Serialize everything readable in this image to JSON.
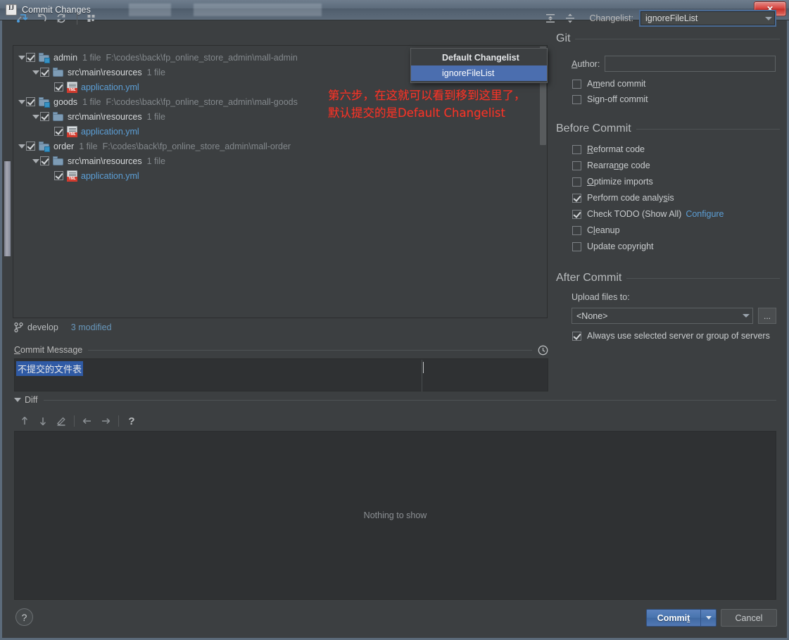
{
  "window": {
    "title": "Commit Changes",
    "app_icon": "intellij-idea-icon",
    "close_label": "✕"
  },
  "toolbar": {
    "buttons": [
      {
        "name": "show-diff-icon",
        "tip": "Show Diff"
      },
      {
        "name": "revert-icon",
        "tip": "Revert"
      },
      {
        "name": "refresh-icon",
        "tip": "Refresh"
      },
      {
        "name": "group-by-icon",
        "tip": "Group By"
      }
    ],
    "expand_all": "expand-all-icon",
    "collapse_all": "collapse-all-icon",
    "changelist_label": "Changelist:",
    "changelist_value": "ignoreFileList"
  },
  "dropdown": {
    "open": true,
    "items": [
      {
        "label": "Default Changelist",
        "bold": true,
        "selected": false
      },
      {
        "label": "ignoreFileList",
        "bold": false,
        "selected": true
      }
    ]
  },
  "tree": [
    {
      "indent": 0,
      "twisty": true,
      "checked": true,
      "icon": "folder-modified-icon",
      "name": "admin",
      "count": "1 file",
      "path": "F:\\codes\\back\\fp_online_store_admin\\mall-admin",
      "link": false
    },
    {
      "indent": 1,
      "twisty": true,
      "checked": true,
      "icon": "folder-icon",
      "name": "src\\main\\resources",
      "count": "1 file",
      "path": "",
      "link": false
    },
    {
      "indent": 2,
      "twisty": false,
      "checked": true,
      "icon": "yml-file-icon",
      "name": "application.yml",
      "count": "",
      "path": "",
      "link": true
    },
    {
      "indent": 0,
      "twisty": true,
      "checked": true,
      "icon": "folder-modified-icon",
      "name": "goods",
      "count": "1 file",
      "path": "F:\\codes\\back\\fp_online_store_admin\\mall-goods",
      "link": false
    },
    {
      "indent": 1,
      "twisty": true,
      "checked": true,
      "icon": "folder-icon",
      "name": "src\\main\\resources",
      "count": "1 file",
      "path": "",
      "link": false
    },
    {
      "indent": 2,
      "twisty": false,
      "checked": true,
      "icon": "yml-file-icon",
      "name": "application.yml",
      "count": "",
      "path": "",
      "link": true
    },
    {
      "indent": 0,
      "twisty": true,
      "checked": true,
      "icon": "folder-modified-icon",
      "name": "order",
      "count": "1 file",
      "path": "F:\\codes\\back\\fp_online_store_admin\\mall-order",
      "link": false
    },
    {
      "indent": 1,
      "twisty": true,
      "checked": true,
      "icon": "folder-icon",
      "name": "src\\main\\resources",
      "count": "1 file",
      "path": "",
      "link": false
    },
    {
      "indent": 2,
      "twisty": false,
      "checked": true,
      "icon": "yml-file-icon",
      "name": "application.yml",
      "count": "",
      "path": "",
      "link": true
    }
  ],
  "annotation": {
    "line1": "第六步，在这就可以看到移到这里了，",
    "line2": "默认提交的是Default Changelist",
    "color": "#f0372b"
  },
  "status": {
    "branch_icon": "git-branch-icon",
    "branch": "develop",
    "modified": "3 modified",
    "modified_color": "#6897bb"
  },
  "commit_message": {
    "label": "Commit Message",
    "history_icon": "clock-history-icon",
    "value": "不提交的文件表",
    "selection_color": "#2f5aa5"
  },
  "diff": {
    "label": "Diff",
    "buttons": [
      {
        "name": "previous-difference-icon",
        "glyph": "↑"
      },
      {
        "name": "next-difference-icon",
        "glyph": "↓"
      },
      {
        "name": "edit-source-icon",
        "glyph": "✎"
      },
      {
        "name": "accept-left-icon",
        "glyph": "←"
      },
      {
        "name": "accept-right-icon",
        "glyph": "→"
      },
      {
        "name": "diff-help-icon",
        "glyph": "?"
      }
    ],
    "empty_text": "Nothing to show"
  },
  "right_panel": {
    "git": {
      "group_label": "Git",
      "author_label": "Author:",
      "author_value": "",
      "checkboxes": [
        {
          "name": "amend-commit",
          "label": "Amend commit",
          "checked": false
        },
        {
          "name": "sign-off-commit",
          "label": "Sign-off commit",
          "checked": false
        }
      ]
    },
    "before_commit": {
      "group_label": "Before Commit",
      "checkboxes": [
        {
          "name": "reformat-code",
          "label": "Reformat code",
          "checked": false
        },
        {
          "name": "rearrange-code",
          "label": "Rearrange code",
          "checked": false
        },
        {
          "name": "optimize-imports",
          "label": "Optimize imports",
          "checked": false
        },
        {
          "name": "perform-code-analysis",
          "label": "Perform code analysis",
          "checked": true
        },
        {
          "name": "check-todo",
          "label": "Check TODO (Show All)",
          "checked": true,
          "link": "Configure"
        },
        {
          "name": "cleanup",
          "label": "Cleanup",
          "checked": false
        },
        {
          "name": "update-copyright",
          "label": "Update copyright",
          "checked": false
        }
      ]
    },
    "after_commit": {
      "group_label": "After Commit",
      "upload_label": "Upload files to:",
      "upload_value": "<None>",
      "browse_label": "...",
      "always_use": {
        "label": "Always use selected server or group of servers",
        "checked": true
      }
    }
  },
  "footer": {
    "help_label": "?",
    "commit_label": "Commit",
    "cancel_label": "Cancel"
  },
  "colors": {
    "background": "#3c3f41",
    "panel": "#2f3133",
    "accent_blue": "#4b6eaf",
    "link": "#5c9fd6",
    "annotation_red": "#f0372b"
  }
}
